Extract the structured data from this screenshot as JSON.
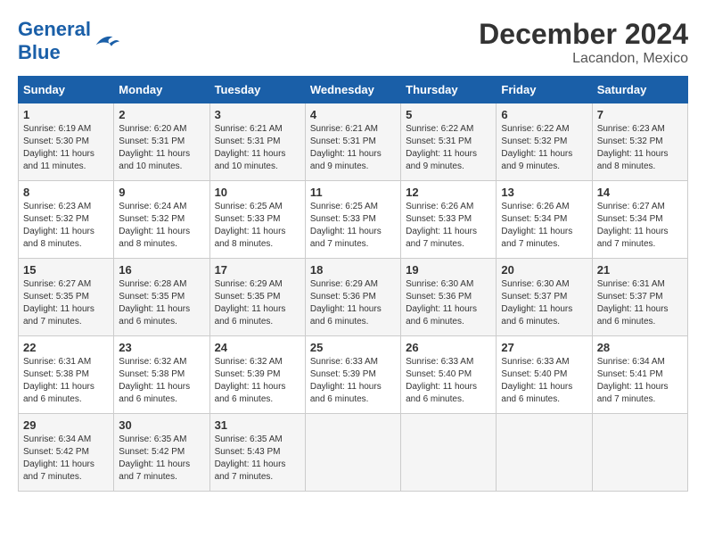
{
  "header": {
    "logo_general": "General",
    "logo_blue": "Blue",
    "month_title": "December 2024",
    "location": "Lacandon, Mexico"
  },
  "days_of_week": [
    "Sunday",
    "Monday",
    "Tuesday",
    "Wednesday",
    "Thursday",
    "Friday",
    "Saturday"
  ],
  "weeks": [
    [
      {
        "day": "1",
        "info": "Sunrise: 6:19 AM\nSunset: 5:30 PM\nDaylight: 11 hours\nand 11 minutes."
      },
      {
        "day": "2",
        "info": "Sunrise: 6:20 AM\nSunset: 5:31 PM\nDaylight: 11 hours\nand 10 minutes."
      },
      {
        "day": "3",
        "info": "Sunrise: 6:21 AM\nSunset: 5:31 PM\nDaylight: 11 hours\nand 10 minutes."
      },
      {
        "day": "4",
        "info": "Sunrise: 6:21 AM\nSunset: 5:31 PM\nDaylight: 11 hours\nand 9 minutes."
      },
      {
        "day": "5",
        "info": "Sunrise: 6:22 AM\nSunset: 5:31 PM\nDaylight: 11 hours\nand 9 minutes."
      },
      {
        "day": "6",
        "info": "Sunrise: 6:22 AM\nSunset: 5:32 PM\nDaylight: 11 hours\nand 9 minutes."
      },
      {
        "day": "7",
        "info": "Sunrise: 6:23 AM\nSunset: 5:32 PM\nDaylight: 11 hours\nand 8 minutes."
      }
    ],
    [
      {
        "day": "8",
        "info": "Sunrise: 6:23 AM\nSunset: 5:32 PM\nDaylight: 11 hours\nand 8 minutes."
      },
      {
        "day": "9",
        "info": "Sunrise: 6:24 AM\nSunset: 5:32 PM\nDaylight: 11 hours\nand 8 minutes."
      },
      {
        "day": "10",
        "info": "Sunrise: 6:25 AM\nSunset: 5:33 PM\nDaylight: 11 hours\nand 8 minutes."
      },
      {
        "day": "11",
        "info": "Sunrise: 6:25 AM\nSunset: 5:33 PM\nDaylight: 11 hours\nand 7 minutes."
      },
      {
        "day": "12",
        "info": "Sunrise: 6:26 AM\nSunset: 5:33 PM\nDaylight: 11 hours\nand 7 minutes."
      },
      {
        "day": "13",
        "info": "Sunrise: 6:26 AM\nSunset: 5:34 PM\nDaylight: 11 hours\nand 7 minutes."
      },
      {
        "day": "14",
        "info": "Sunrise: 6:27 AM\nSunset: 5:34 PM\nDaylight: 11 hours\nand 7 minutes."
      }
    ],
    [
      {
        "day": "15",
        "info": "Sunrise: 6:27 AM\nSunset: 5:35 PM\nDaylight: 11 hours\nand 7 minutes."
      },
      {
        "day": "16",
        "info": "Sunrise: 6:28 AM\nSunset: 5:35 PM\nDaylight: 11 hours\nand 6 minutes."
      },
      {
        "day": "17",
        "info": "Sunrise: 6:29 AM\nSunset: 5:35 PM\nDaylight: 11 hours\nand 6 minutes."
      },
      {
        "day": "18",
        "info": "Sunrise: 6:29 AM\nSunset: 5:36 PM\nDaylight: 11 hours\nand 6 minutes."
      },
      {
        "day": "19",
        "info": "Sunrise: 6:30 AM\nSunset: 5:36 PM\nDaylight: 11 hours\nand 6 minutes."
      },
      {
        "day": "20",
        "info": "Sunrise: 6:30 AM\nSunset: 5:37 PM\nDaylight: 11 hours\nand 6 minutes."
      },
      {
        "day": "21",
        "info": "Sunrise: 6:31 AM\nSunset: 5:37 PM\nDaylight: 11 hours\nand 6 minutes."
      }
    ],
    [
      {
        "day": "22",
        "info": "Sunrise: 6:31 AM\nSunset: 5:38 PM\nDaylight: 11 hours\nand 6 minutes."
      },
      {
        "day": "23",
        "info": "Sunrise: 6:32 AM\nSunset: 5:38 PM\nDaylight: 11 hours\nand 6 minutes."
      },
      {
        "day": "24",
        "info": "Sunrise: 6:32 AM\nSunset: 5:39 PM\nDaylight: 11 hours\nand 6 minutes."
      },
      {
        "day": "25",
        "info": "Sunrise: 6:33 AM\nSunset: 5:39 PM\nDaylight: 11 hours\nand 6 minutes."
      },
      {
        "day": "26",
        "info": "Sunrise: 6:33 AM\nSunset: 5:40 PM\nDaylight: 11 hours\nand 6 minutes."
      },
      {
        "day": "27",
        "info": "Sunrise: 6:33 AM\nSunset: 5:40 PM\nDaylight: 11 hours\nand 6 minutes."
      },
      {
        "day": "28",
        "info": "Sunrise: 6:34 AM\nSunset: 5:41 PM\nDaylight: 11 hours\nand 7 minutes."
      }
    ],
    [
      {
        "day": "29",
        "info": "Sunrise: 6:34 AM\nSunset: 5:42 PM\nDaylight: 11 hours\nand 7 minutes."
      },
      {
        "day": "30",
        "info": "Sunrise: 6:35 AM\nSunset: 5:42 PM\nDaylight: 11 hours\nand 7 minutes."
      },
      {
        "day": "31",
        "info": "Sunrise: 6:35 AM\nSunset: 5:43 PM\nDaylight: 11 hours\nand 7 minutes."
      },
      {
        "day": "",
        "info": ""
      },
      {
        "day": "",
        "info": ""
      },
      {
        "day": "",
        "info": ""
      },
      {
        "day": "",
        "info": ""
      }
    ]
  ]
}
